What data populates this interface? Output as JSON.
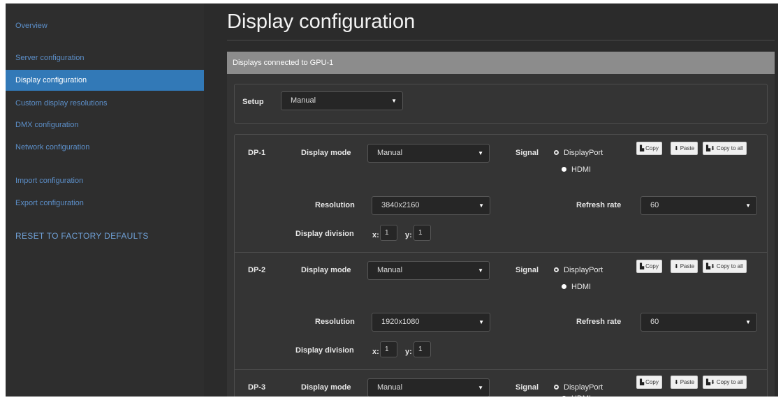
{
  "sidebar": {
    "items": [
      {
        "label": "Overview"
      },
      {
        "label": "Server configuration"
      },
      {
        "label": "Display configuration",
        "active": true
      },
      {
        "label": "Custom display resolutions"
      },
      {
        "label": "DMX configuration"
      },
      {
        "label": "Network configuration"
      },
      {
        "label": "Import configuration"
      },
      {
        "label": "Export configuration"
      },
      {
        "label": "RESET TO FACTORY DEFAULTS"
      }
    ]
  },
  "main": {
    "title": "Display configuration",
    "panel_title": "Displays connected to GPU-1",
    "setup": {
      "label": "Setup",
      "value": "Manual"
    },
    "labels": {
      "display_mode": "Display mode",
      "signal": "Signal",
      "resolution": "Resolution",
      "refresh_rate": "Refresh rate",
      "display_division": "Display division",
      "x": "x:",
      "y": "y:"
    },
    "signal_options": [
      "DisplayPort",
      "HDMI"
    ],
    "buttons": {
      "copy": "Copy",
      "paste": "Paste",
      "copy_to_all": "Copy to all"
    },
    "displays": [
      {
        "name": "DP-1",
        "mode": "Manual",
        "signal": "DisplayPort",
        "resolution": "3840x2160",
        "refresh_rate": "60",
        "division_x": "1",
        "division_y": "1"
      },
      {
        "name": "DP-2",
        "mode": "Manual",
        "signal": "DisplayPort",
        "resolution": "1920x1080",
        "refresh_rate": "60",
        "division_x": "1",
        "division_y": "1"
      },
      {
        "name": "DP-3",
        "mode": "Manual",
        "signal": "DisplayPort"
      }
    ]
  },
  "colors": {
    "accent": "#3279b7",
    "link": "#5c8fc9",
    "panel_header": "#8c8c8c",
    "background": "#2b2b2b"
  },
  "icons": {
    "copy": "copy-icon",
    "paste": "paste-icon",
    "copy_to_all": "copy-to-all-icon",
    "dropdown": "caret-down-icon"
  }
}
